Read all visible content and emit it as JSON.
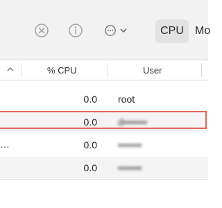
{
  "toolbar": {
    "stop_icon": "stop-process-icon",
    "info_icon": "info-icon",
    "more_icon": "more-options-icon",
    "tabs": [
      "CPU",
      "Mo"
    ]
  },
  "header": {
    "cpu_label": "% CPU",
    "user_label": "User"
  },
  "rows": [
    {
      "prefix": "",
      "cpu": "0.0",
      "user": "root"
    },
    {
      "prefix": "",
      "cpu": "0.0",
      "user": "d•••••••"
    },
    {
      "prefix": "…",
      "cpu": "0.0",
      "user": "•••••••"
    },
    {
      "prefix": "",
      "cpu": "0.0",
      "user": "•••••••"
    }
  ],
  "colors": {
    "highlight": "#e06a52",
    "selected_tab": "#e2e2e2",
    "toolbar_bg": "#f2f2f2"
  }
}
